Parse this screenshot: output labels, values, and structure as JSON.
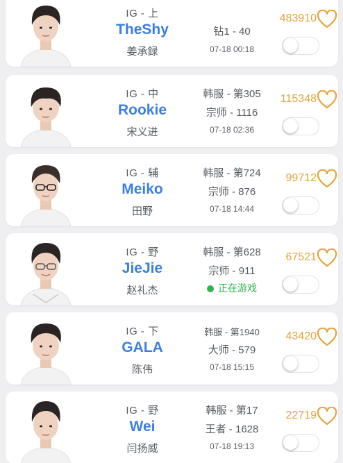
{
  "accent_colors": {
    "player_name": "#3b7fe0",
    "likes": "#e4a43a",
    "in_game": "#2fb34a"
  },
  "players": [
    {
      "team_role": "IG - 上",
      "name": "TheShy",
      "real_name": "姜承録",
      "rank_line1": "",
      "rank_line2": "钻1 - 40",
      "last_seen": "07-18 00:18",
      "status": "",
      "likes": "483910",
      "follow_toggle": "off"
    },
    {
      "team_role": "IG - 中",
      "name": "Rookie",
      "real_name": "宋义进",
      "rank_line1": "韩服 - 第305",
      "rank_line2": "宗师 - 1116",
      "last_seen": "07-18 02:36",
      "status": "",
      "likes": "115348",
      "follow_toggle": "off"
    },
    {
      "team_role": "IG - 辅",
      "name": "Meiko",
      "real_name": "田野",
      "rank_line1": "韩服 - 第724",
      "rank_line2": "宗师 - 876",
      "last_seen": "07-18 14:44",
      "status": "",
      "likes": "99712",
      "follow_toggle": "off"
    },
    {
      "team_role": "IG - 野",
      "name": "JieJie",
      "real_name": "赵礼杰",
      "rank_line1": "韩服 - 第628",
      "rank_line2": "宗师 - 911",
      "last_seen": "",
      "status": "正在游戏",
      "likes": "67521",
      "follow_toggle": "off"
    },
    {
      "team_role": "IG - 下",
      "name": "GALA",
      "real_name": "陈伟",
      "rank_line1": "韩服 - 第1940",
      "rank_line2": "大师 - 579",
      "last_seen": "07-18 15:15",
      "status": "",
      "likes": "43420",
      "follow_toggle": "off"
    },
    {
      "team_role": "IG - 野",
      "name": "Wei",
      "real_name": "闫扬威",
      "rank_line1": "韩服 - 第17",
      "rank_line2": "王者 - 1628",
      "last_seen": "07-18 19:13",
      "status": "",
      "likes": "22719",
      "follow_toggle": "off"
    }
  ]
}
